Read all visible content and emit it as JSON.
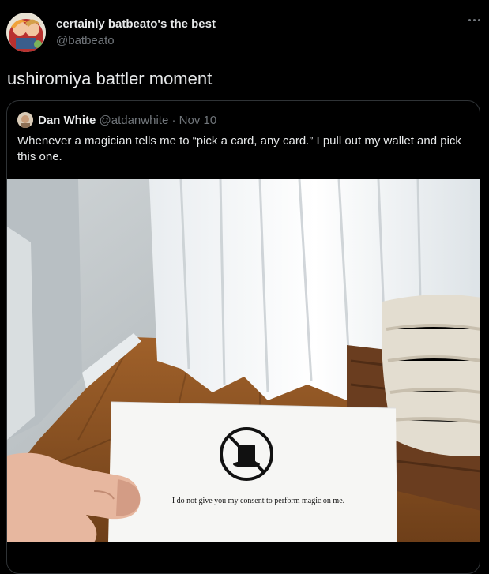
{
  "tweet": {
    "display_name": "certainly batbeato's the best",
    "handle": "@batbeato",
    "text": "ushiromiya battler moment",
    "more_icon": "more-horizontal-icon"
  },
  "quoted": {
    "name": "Dan White",
    "handle": "@atdanwhite",
    "separator": "·",
    "date": "Nov 10",
    "text": "Whenever a magician tells me to “pick a card, any card.” I pull out my wallet and pick this one.",
    "card_text": "I do not give you my consent to perform magic on me."
  },
  "colors": {
    "background": "#000000",
    "text_primary": "#e7e9ea",
    "text_secondary": "#71767b",
    "border": "#2f3336"
  }
}
